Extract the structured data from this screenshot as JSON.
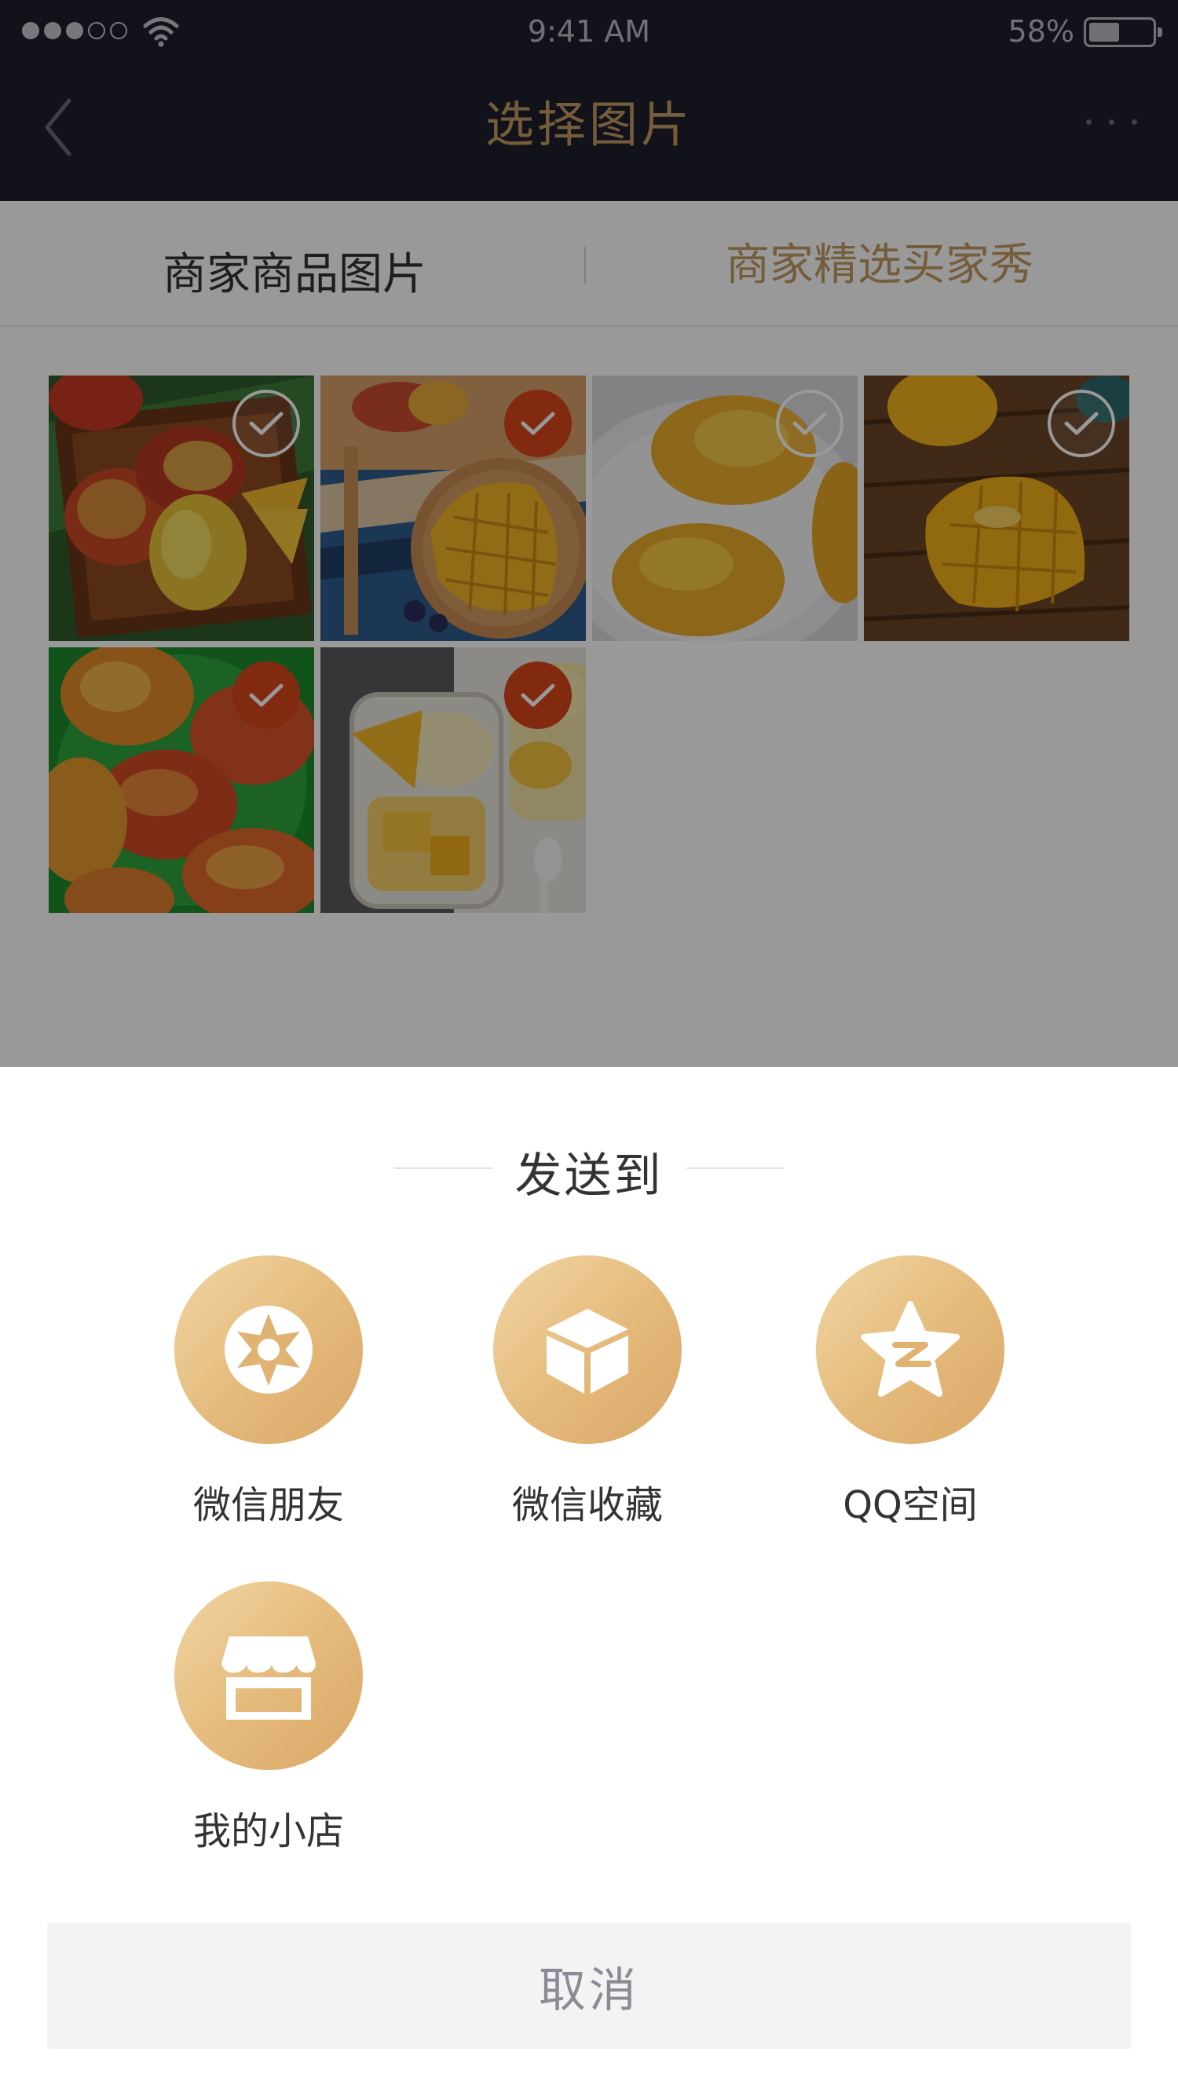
{
  "status_bar": {
    "time": "9:41 AM",
    "battery": "58%"
  },
  "nav": {
    "title": "选择图片"
  },
  "tabs": [
    {
      "label": "商家商品图片",
      "active": false
    },
    {
      "label": "商家精选买家秀",
      "active": true
    }
  ],
  "images": [
    {
      "name": "mangoes-on-wooden-tray",
      "selected": false
    },
    {
      "name": "mango-hedgehog-on-plate",
      "selected": true
    },
    {
      "name": "mangoes-on-white-plate",
      "selected": false
    },
    {
      "name": "cut-mango-on-wood",
      "selected": false
    },
    {
      "name": "mangoes-in-green-bowl",
      "selected": true
    },
    {
      "name": "mango-ice-cream-jar",
      "selected": true
    }
  ],
  "share_sheet": {
    "title": "发送到",
    "items": [
      {
        "label": "微信朋友",
        "icon": "wechat-moments-icon"
      },
      {
        "label": "微信收藏",
        "icon": "wechat-favorites-icon"
      },
      {
        "label": "QQ空间",
        "icon": "qzone-icon"
      },
      {
        "label": "我的小店",
        "icon": "shop-icon"
      }
    ],
    "cancel_label": "取消"
  },
  "colors": {
    "accent_gold": "#c39a62",
    "selected_check": "#d9461c",
    "top_bar": "#1f1e2c"
  }
}
